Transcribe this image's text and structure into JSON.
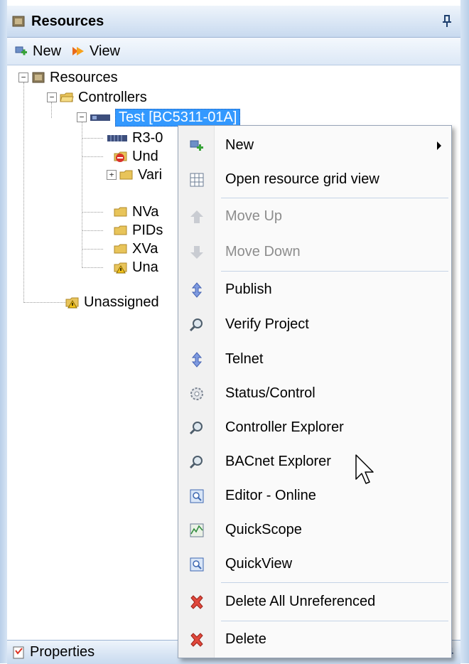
{
  "panel": {
    "title": "Resources",
    "toolbar": {
      "new_label": "New",
      "view_label": "View"
    }
  },
  "tree": {
    "root": "Resources",
    "controllers": "Controllers",
    "selected_controller": "Test [BC5311-01A]",
    "children": [
      "R3-0",
      "Und",
      "Vari",
      "NVa",
      "PIDs",
      "XVa",
      "Una"
    ],
    "unassigned": "Unassigned"
  },
  "properties": {
    "label": "Properties"
  },
  "context_menu": {
    "items": [
      {
        "label": "New",
        "icon": "add-icon",
        "enabled": true,
        "submenu": true
      },
      {
        "label": "Open resource grid view",
        "icon": "grid-icon",
        "enabled": true
      },
      {
        "label": "Move Up",
        "icon": "arrow-up-icon",
        "enabled": false
      },
      {
        "label": "Move Down",
        "icon": "arrow-down-icon",
        "enabled": false
      },
      {
        "label": "Publish",
        "icon": "up-down-arrow-icon",
        "enabled": true
      },
      {
        "label": "Verify Project",
        "icon": "magnifier-icon",
        "enabled": true
      },
      {
        "label": "Telnet",
        "icon": "up-down-arrow-icon",
        "enabled": true
      },
      {
        "label": "Status/Control",
        "icon": "gear-icon",
        "enabled": true
      },
      {
        "label": "Controller Explorer",
        "icon": "magnifier-icon",
        "enabled": true
      },
      {
        "label": "BACnet Explorer",
        "icon": "magnifier-icon",
        "enabled": true
      },
      {
        "label": "Editor - Online",
        "icon": "window-search-icon",
        "enabled": true
      },
      {
        "label": "QuickScope",
        "icon": "scope-icon",
        "enabled": true
      },
      {
        "label": "QuickView",
        "icon": "window-search-icon",
        "enabled": true
      },
      {
        "label": "Delete All Unreferenced",
        "icon": "delete-x-icon",
        "enabled": true
      },
      {
        "label": "Delete",
        "icon": "delete-x-icon",
        "enabled": true
      }
    ]
  },
  "colors": {
    "selection": "#3399ff",
    "folder": "#e8c45a",
    "delete": "#e0483c"
  }
}
